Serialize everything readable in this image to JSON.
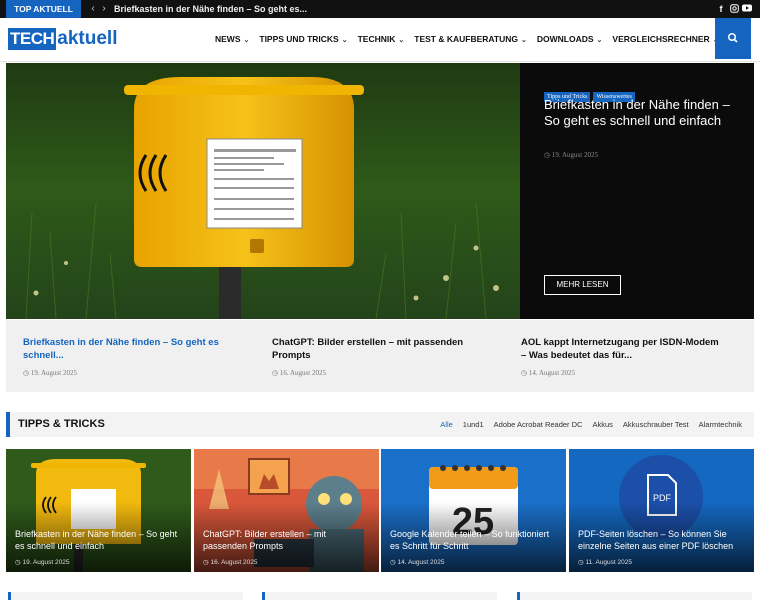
{
  "topbar": {
    "tag": "TOP AKTUELL",
    "ticker": "Briefkasten in der Nähe finden – So geht es...",
    "social": [
      "facebook-icon",
      "instagram-icon",
      "youtube-icon"
    ]
  },
  "header": {
    "logo_tech": "TECH",
    "logo_aktuell": "aktuell",
    "nav": [
      {
        "label": "NEWS",
        "dropdown": true
      },
      {
        "label": "TIPPS UND TRICKS",
        "dropdown": true
      },
      {
        "label": "TECHNIK",
        "dropdown": true
      },
      {
        "label": "TEST & KAUFBERATUNG",
        "dropdown": true
      },
      {
        "label": "DOWNLOADS",
        "dropdown": true
      },
      {
        "label": "VERGLEICHSRECHNER",
        "dropdown": true
      }
    ]
  },
  "hero": {
    "categories": [
      "Tipps und Tricks",
      "Wissenswertes"
    ],
    "title": "Briefkasten in der Nähe finden – So geht es schnell und einfach",
    "date": "19. August 2025",
    "more_label": "MEHR LESEN"
  },
  "related": [
    {
      "title": "Briefkasten in der Nähe finden – So geht es schnell...",
      "date": "19. August 2025"
    },
    {
      "title": "ChatGPT: Bilder erstellen – mit passenden Prompts",
      "date": "16. August 2025"
    },
    {
      "title": "AOL kappt Internetzugang per ISDN-Modem – Was bedeutet das für...",
      "date": "14. August 2025"
    }
  ],
  "section": {
    "title": "TIPPS & TRICKS",
    "filters": [
      "Alle",
      "1und1",
      "Adobe Acrobat Reader DC",
      "Akkus",
      "Akkuschrauber Test",
      "Alarmtechnik"
    ]
  },
  "cards": [
    {
      "title": "Briefkasten in der Nähe finden – So geht es schnell und einfach",
      "date": "19. August 2025"
    },
    {
      "title": "ChatGPT: Bilder erstellen – mit passenden Prompts",
      "date": "16. August 2025"
    },
    {
      "title": "Google Kalender teilen – So funktioniert es Schritt für Schritt",
      "date": "14. August 2025",
      "calendar_day": "25"
    },
    {
      "title": "PDF-Seiten löschen – So können Sie einzelne Seiten aus einer PDF löschen",
      "date": "11. August 2025",
      "badge": "PDF"
    }
  ],
  "colors": {
    "accent": "#1565c0",
    "dark": "#0b0b0b",
    "strip": "#f0f0f0"
  }
}
